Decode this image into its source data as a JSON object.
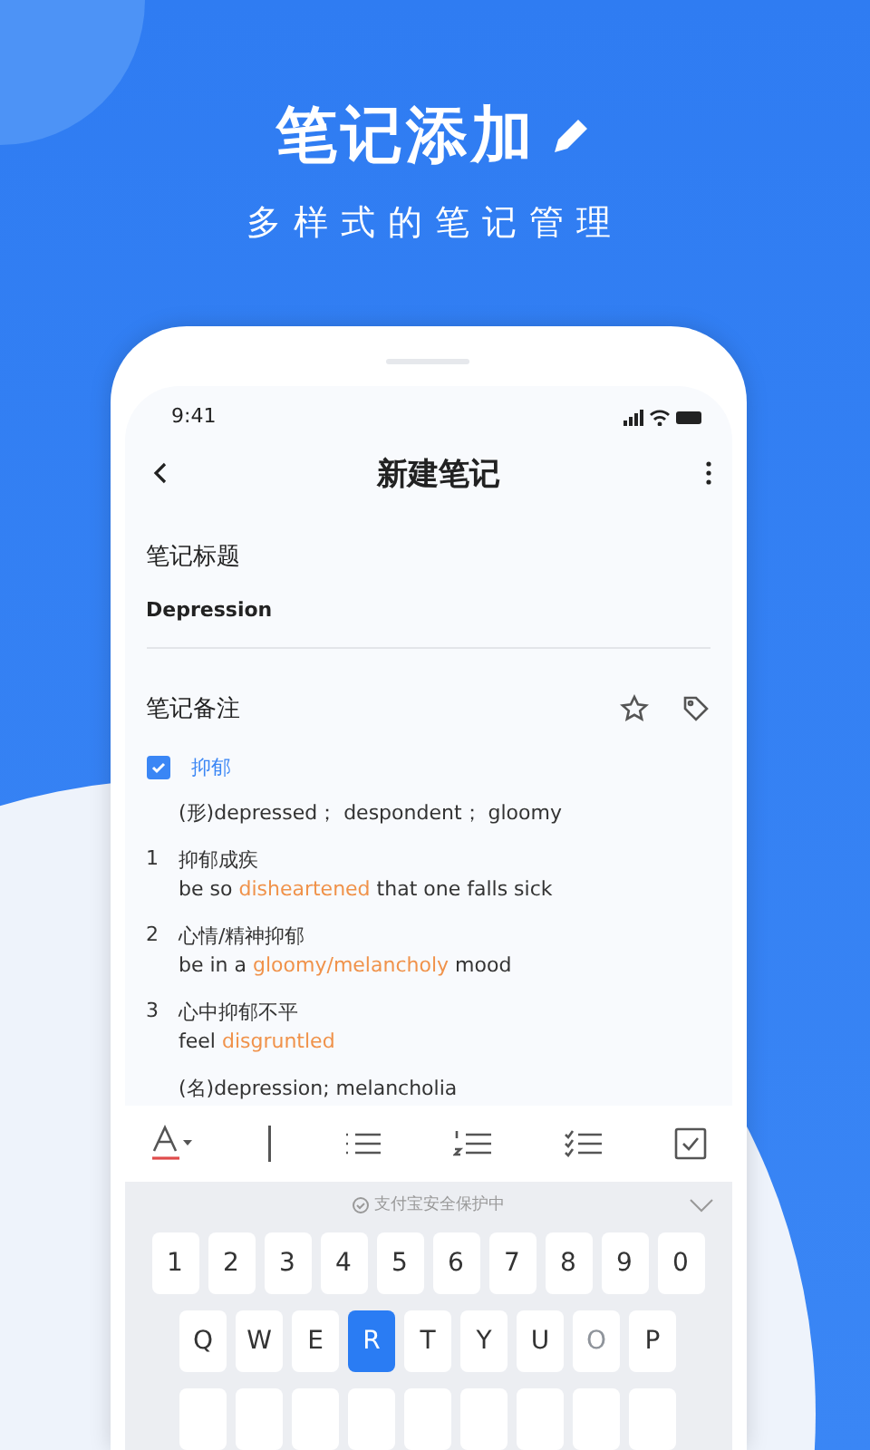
{
  "hero": {
    "title": "笔记添加",
    "subtitle": "多样式的笔记管理"
  },
  "phone": {
    "status_bar": {
      "time": "9:41"
    },
    "header": {
      "title": "新建笔记"
    },
    "title_field": {
      "label": "笔记标题",
      "value": "Depression"
    },
    "notes": {
      "label": "笔记备注",
      "word": {
        "label": "抑郁",
        "checked": true
      },
      "entries": [
        {
          "kind": "pos",
          "text": "(形)depressed； despondent； gloomy"
        },
        {
          "kind": "sense",
          "number": "1",
          "chinese": "抑郁成疾",
          "parts": [
            {
              "text": "be so ",
              "highlighted": false
            },
            {
              "text": "disheartened",
              "highlighted": true
            },
            {
              "text": " that one falls sick",
              "highlighted": false
            }
          ]
        },
        {
          "kind": "sense",
          "number": "2",
          "chinese": "心情/精神抑郁",
          "parts": [
            {
              "text": "be in a ",
              "highlighted": false
            },
            {
              "text": "gloomy/melancholy",
              "highlighted": true
            },
            {
              "text": " mood",
              "highlighted": false
            }
          ]
        },
        {
          "kind": "sense",
          "number": "3",
          "chinese": "心中抑郁不平",
          "parts": [
            {
              "text": "feel ",
              "highlighted": false
            },
            {
              "text": "disgruntled",
              "highlighted": true
            }
          ]
        },
        {
          "kind": "pos",
          "text": "(名)depression; melancholia"
        }
      ]
    },
    "keyboard": {
      "security_text": "支付宝安全保护中",
      "rows": [
        {
          "keys": [
            {
              "label": "1",
              "selected": false,
              "disabled": false
            },
            {
              "label": "2",
              "selected": false,
              "disabled": false
            },
            {
              "label": "3",
              "selected": false,
              "disabled": false
            },
            {
              "label": "4",
              "selected": false,
              "disabled": false
            },
            {
              "label": "5",
              "selected": false,
              "disabled": false
            },
            {
              "label": "6",
              "selected": false,
              "disabled": false
            },
            {
              "label": "7",
              "selected": false,
              "disabled": false
            },
            {
              "label": "8",
              "selected": false,
              "disabled": false
            },
            {
              "label": "9",
              "selected": false,
              "disabled": false
            },
            {
              "label": "0",
              "selected": false,
              "disabled": false
            }
          ]
        },
        {
          "keys": [
            {
              "label": "Q",
              "selected": false,
              "disabled": false
            },
            {
              "label": "W",
              "selected": false,
              "disabled": false
            },
            {
              "label": "E",
              "selected": false,
              "disabled": false
            },
            {
              "label": "R",
              "selected": true,
              "disabled": false
            },
            {
              "label": "T",
              "selected": false,
              "disabled": false
            },
            {
              "label": "Y",
              "selected": false,
              "disabled": false
            },
            {
              "label": "U",
              "selected": false,
              "disabled": false
            },
            {
              "label": "O",
              "selected": false,
              "disabled": true
            },
            {
              "label": "P",
              "selected": false,
              "disabled": false
            }
          ]
        }
      ]
    }
  }
}
